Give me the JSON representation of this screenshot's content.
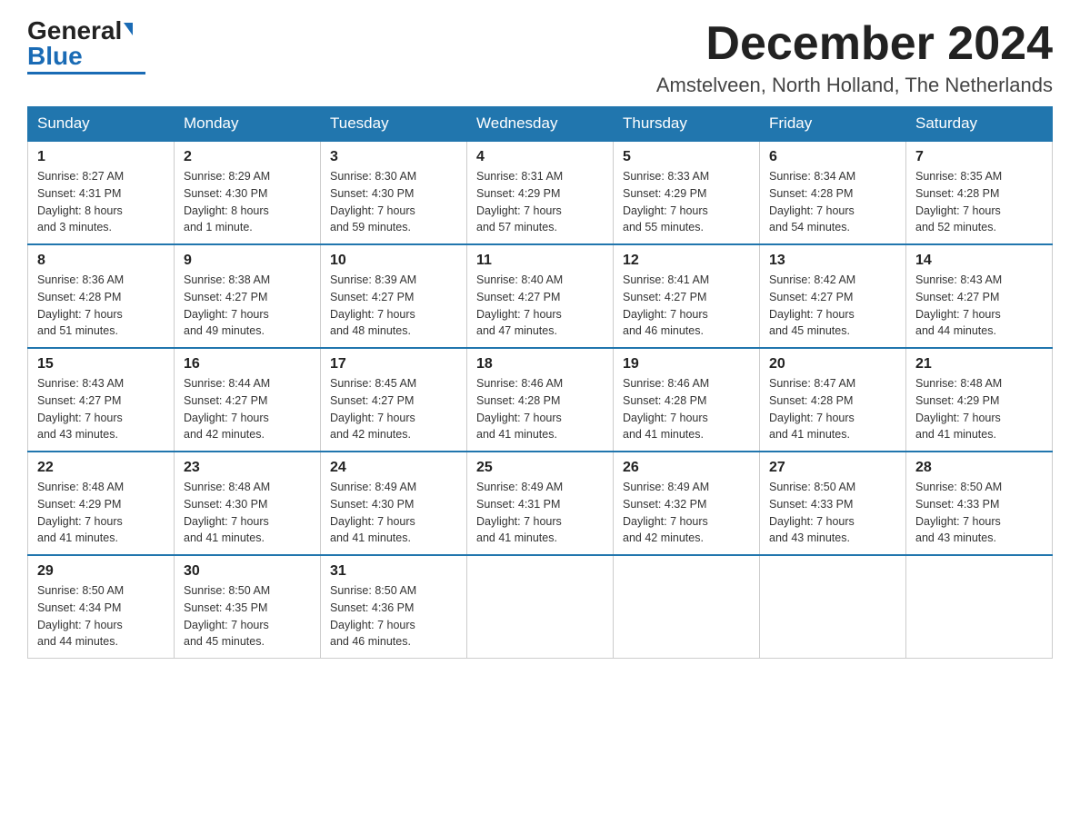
{
  "logo": {
    "general": "General",
    "blue": "Blue"
  },
  "title": "December 2024",
  "subtitle": "Amstelveen, North Holland, The Netherlands",
  "weekdays": [
    "Sunday",
    "Monday",
    "Tuesday",
    "Wednesday",
    "Thursday",
    "Friday",
    "Saturday"
  ],
  "weeks": [
    [
      {
        "day": "1",
        "info": "Sunrise: 8:27 AM\nSunset: 4:31 PM\nDaylight: 8 hours\nand 3 minutes."
      },
      {
        "day": "2",
        "info": "Sunrise: 8:29 AM\nSunset: 4:30 PM\nDaylight: 8 hours\nand 1 minute."
      },
      {
        "day": "3",
        "info": "Sunrise: 8:30 AM\nSunset: 4:30 PM\nDaylight: 7 hours\nand 59 minutes."
      },
      {
        "day": "4",
        "info": "Sunrise: 8:31 AM\nSunset: 4:29 PM\nDaylight: 7 hours\nand 57 minutes."
      },
      {
        "day": "5",
        "info": "Sunrise: 8:33 AM\nSunset: 4:29 PM\nDaylight: 7 hours\nand 55 minutes."
      },
      {
        "day": "6",
        "info": "Sunrise: 8:34 AM\nSunset: 4:28 PM\nDaylight: 7 hours\nand 54 minutes."
      },
      {
        "day": "7",
        "info": "Sunrise: 8:35 AM\nSunset: 4:28 PM\nDaylight: 7 hours\nand 52 minutes."
      }
    ],
    [
      {
        "day": "8",
        "info": "Sunrise: 8:36 AM\nSunset: 4:28 PM\nDaylight: 7 hours\nand 51 minutes."
      },
      {
        "day": "9",
        "info": "Sunrise: 8:38 AM\nSunset: 4:27 PM\nDaylight: 7 hours\nand 49 minutes."
      },
      {
        "day": "10",
        "info": "Sunrise: 8:39 AM\nSunset: 4:27 PM\nDaylight: 7 hours\nand 48 minutes."
      },
      {
        "day": "11",
        "info": "Sunrise: 8:40 AM\nSunset: 4:27 PM\nDaylight: 7 hours\nand 47 minutes."
      },
      {
        "day": "12",
        "info": "Sunrise: 8:41 AM\nSunset: 4:27 PM\nDaylight: 7 hours\nand 46 minutes."
      },
      {
        "day": "13",
        "info": "Sunrise: 8:42 AM\nSunset: 4:27 PM\nDaylight: 7 hours\nand 45 minutes."
      },
      {
        "day": "14",
        "info": "Sunrise: 8:43 AM\nSunset: 4:27 PM\nDaylight: 7 hours\nand 44 minutes."
      }
    ],
    [
      {
        "day": "15",
        "info": "Sunrise: 8:43 AM\nSunset: 4:27 PM\nDaylight: 7 hours\nand 43 minutes."
      },
      {
        "day": "16",
        "info": "Sunrise: 8:44 AM\nSunset: 4:27 PM\nDaylight: 7 hours\nand 42 minutes."
      },
      {
        "day": "17",
        "info": "Sunrise: 8:45 AM\nSunset: 4:27 PM\nDaylight: 7 hours\nand 42 minutes."
      },
      {
        "day": "18",
        "info": "Sunrise: 8:46 AM\nSunset: 4:28 PM\nDaylight: 7 hours\nand 41 minutes."
      },
      {
        "day": "19",
        "info": "Sunrise: 8:46 AM\nSunset: 4:28 PM\nDaylight: 7 hours\nand 41 minutes."
      },
      {
        "day": "20",
        "info": "Sunrise: 8:47 AM\nSunset: 4:28 PM\nDaylight: 7 hours\nand 41 minutes."
      },
      {
        "day": "21",
        "info": "Sunrise: 8:48 AM\nSunset: 4:29 PM\nDaylight: 7 hours\nand 41 minutes."
      }
    ],
    [
      {
        "day": "22",
        "info": "Sunrise: 8:48 AM\nSunset: 4:29 PM\nDaylight: 7 hours\nand 41 minutes."
      },
      {
        "day": "23",
        "info": "Sunrise: 8:48 AM\nSunset: 4:30 PM\nDaylight: 7 hours\nand 41 minutes."
      },
      {
        "day": "24",
        "info": "Sunrise: 8:49 AM\nSunset: 4:30 PM\nDaylight: 7 hours\nand 41 minutes."
      },
      {
        "day": "25",
        "info": "Sunrise: 8:49 AM\nSunset: 4:31 PM\nDaylight: 7 hours\nand 41 minutes."
      },
      {
        "day": "26",
        "info": "Sunrise: 8:49 AM\nSunset: 4:32 PM\nDaylight: 7 hours\nand 42 minutes."
      },
      {
        "day": "27",
        "info": "Sunrise: 8:50 AM\nSunset: 4:33 PM\nDaylight: 7 hours\nand 43 minutes."
      },
      {
        "day": "28",
        "info": "Sunrise: 8:50 AM\nSunset: 4:33 PM\nDaylight: 7 hours\nand 43 minutes."
      }
    ],
    [
      {
        "day": "29",
        "info": "Sunrise: 8:50 AM\nSunset: 4:34 PM\nDaylight: 7 hours\nand 44 minutes."
      },
      {
        "day": "30",
        "info": "Sunrise: 8:50 AM\nSunset: 4:35 PM\nDaylight: 7 hours\nand 45 minutes."
      },
      {
        "day": "31",
        "info": "Sunrise: 8:50 AM\nSunset: 4:36 PM\nDaylight: 7 hours\nand 46 minutes."
      },
      null,
      null,
      null,
      null
    ]
  ]
}
